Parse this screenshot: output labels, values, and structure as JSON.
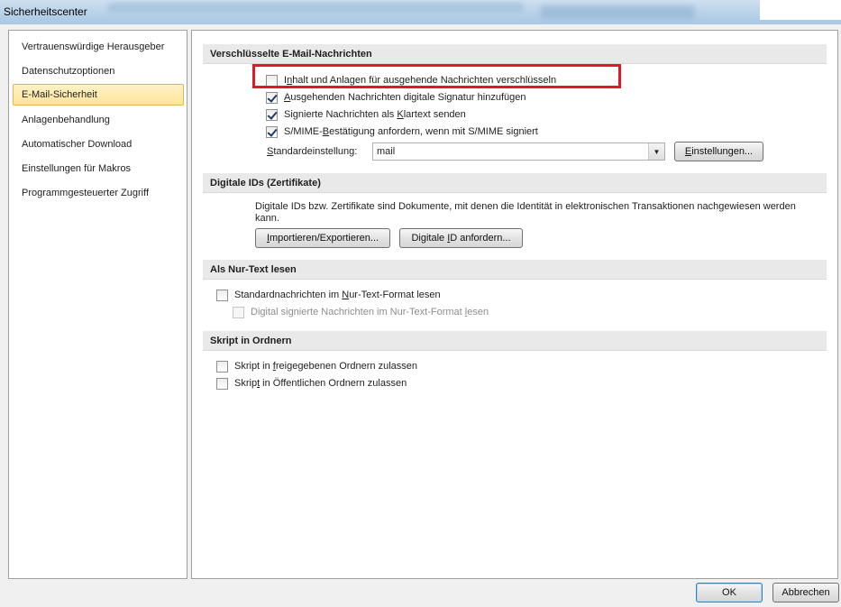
{
  "window": {
    "title": "Sicherheitscenter"
  },
  "nav": {
    "items": [
      {
        "label": "Vertrauenswürdige Herausgeber",
        "selected": false
      },
      {
        "label": "Datenschutzoptionen",
        "selected": false
      },
      {
        "label": "E-Mail-Sicherheit",
        "selected": true
      },
      {
        "label": "Anlagenbehandlung",
        "selected": false
      },
      {
        "label": "Automatischer Download",
        "selected": false
      },
      {
        "label": "Einstellungen für Makros",
        "selected": false
      },
      {
        "label": "Programmgesteuerter Zugriff",
        "selected": false
      }
    ]
  },
  "encrypted": {
    "header": "Verschlüsselte E-Mail-Nachrichten",
    "options": [
      {
        "pre": "I",
        "u": "n",
        "post": "halt und Anlagen für ausgehende Nachrichten verschlüsseln",
        "checked": false
      },
      {
        "pre": "",
        "u": "A",
        "post": "usgehenden Nachrichten digitale Signatur hinzufügen",
        "checked": true
      },
      {
        "pre": "Signierte Nachrichten als ",
        "u": "K",
        "post": "lartext senden",
        "checked": true
      },
      {
        "pre": "S/MIME-",
        "u": "B",
        "post": "estätigung anfordern, wenn mit S/MIME signiert",
        "checked": true
      }
    ],
    "default_label_u": "S",
    "default_label_rest": "tandardeinstellung:",
    "default_value": "mail",
    "settings_button_u": "E",
    "settings_button_rest": "instellungen..."
  },
  "digital_ids": {
    "header": "Digitale IDs (Zertifikate)",
    "description": "Digitale IDs bzw. Zertifikate sind Dokumente, mit denen die Identität in elektronischen Transaktionen nachgewiesen werden kann.",
    "import_u": "I",
    "import_rest": "mportieren/Exportieren...",
    "request_pre": "Digitale ",
    "request_u": "I",
    "request_rest": "D anfordern..."
  },
  "plain_text": {
    "header": "Als Nur-Text lesen",
    "option1_pre": "Standardnachrichten im ",
    "option1_u": "N",
    "option1_post": "ur-Text-Format lesen",
    "option1_checked": false,
    "option2_pre": "Digital signierte Nachrichten im Nur-Text-Format ",
    "option2_u": "l",
    "option2_post": "esen",
    "option2_checked": false
  },
  "script": {
    "header": "Skript in Ordnern",
    "option1_pre": "Skript in ",
    "option1_u": "f",
    "option1_post": "reigegebenen Ordnern zulassen",
    "option1_checked": false,
    "option2_pre": "Skrip",
    "option2_u": "t",
    "option2_post": " in Öffentlichen Ordnern zulassen",
    "option2_checked": false
  },
  "footer": {
    "ok": "OK",
    "cancel": "Abbrechen"
  },
  "colors": {
    "highlight": "#e0192a",
    "selected_nav": "#ffe39a"
  }
}
